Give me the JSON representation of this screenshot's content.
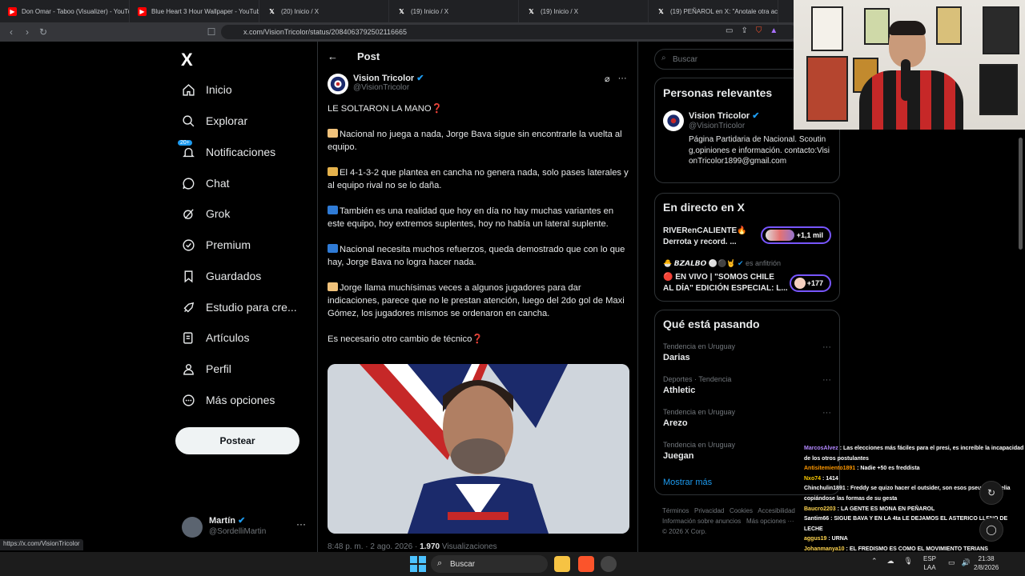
{
  "browser": {
    "tabs": [
      {
        "title": "Don Omar - Taboo (Visualizer) - YouTube",
        "icon": "youtube-icon"
      },
      {
        "title": "Blue Heart 3 Hour Wallpaper - YouTube",
        "icon": "youtube-icon"
      },
      {
        "title": "(20) Inicio / X",
        "icon": "x-icon"
      },
      {
        "title": "(19) Inicio / X",
        "icon": "x-icon"
      },
      {
        "title": "(19) Inicio / X",
        "icon": "x-icon"
      },
      {
        "title": "(19) PEÑAROL en X: \"Anotale otra ac",
        "icon": "x-icon"
      }
    ],
    "url": "x.com/VisionTricolor/status/2084063792502116665",
    "status_link": "https://x.com/VisionTricolor"
  },
  "sidebar": {
    "logo": "X",
    "items": [
      {
        "label": "Inicio",
        "icon": "home-icon"
      },
      {
        "label": "Explorar",
        "icon": "search-icon"
      },
      {
        "label": "Notificaciones",
        "icon": "bell-icon",
        "badge": "20+"
      },
      {
        "label": "Chat",
        "icon": "chat-icon"
      },
      {
        "label": "Grok",
        "icon": "grok-icon"
      },
      {
        "label": "Premium",
        "icon": "premium-icon"
      },
      {
        "label": "Guardados",
        "icon": "bookmark-icon"
      },
      {
        "label": "Estudio para cre...",
        "icon": "rocket-icon"
      },
      {
        "label": "Artículos",
        "icon": "article-icon"
      },
      {
        "label": "Perfil",
        "icon": "person-icon"
      },
      {
        "label": "Más opciones",
        "icon": "more-circle-icon"
      }
    ],
    "post_button": "Postear",
    "account": {
      "name": "Martín",
      "handle": "@SordelliMartin"
    }
  },
  "post": {
    "header": "Post",
    "author": {
      "name": "Vision Tricolor",
      "handle": "@VisionTricolor"
    },
    "paragraphs": [
      {
        "emoji": "",
        "text": "LE SOLTARON LA MANO❓"
      },
      {
        "emoji": "thumbs-down",
        "text": "Nacional no juega a nada, Jorge Bava sigue sin encontrarle la vuelta al equipo."
      },
      {
        "emoji": "person",
        "text": "El 4-1-3-2 que plantea en cancha no genera nada, solo pases laterales y al equipo rival no se lo daña."
      },
      {
        "emoji": "arrow",
        "text": "También es una realidad que hoy en día no hay muchas variantes en este equipo, hoy extremos suplentes, hoy no había un lateral suplente."
      },
      {
        "emoji": "arrow",
        "text": "Nacional necesita muchos refuerzos, queda demostrado que con lo que hay, Jorge Bava no logra hacer nada."
      },
      {
        "emoji": "pointing",
        "text": "Jorge llama muchísimas veces a algunos jugadores para dar indicaciones, parece que no le prestan atención, luego del 2do gol de Maxi Gómez, los jugadores mismos se ordenaron en cancha."
      },
      {
        "emoji": "",
        "text": "Es necesario otro cambio de técnico❓"
      }
    ],
    "meta": {
      "time": "8:48 p. m. · 2 ago. 2026 · ",
      "views": "1.970",
      "views_label": " Visualizaciones"
    }
  },
  "right": {
    "search_placeholder": "Buscar",
    "relevant": {
      "title": "Personas relevantes",
      "name": "Vision Tricolor",
      "handle": "@VisionTricolor",
      "bio": "Página Partidaria de Nacional. Scouting,opiniones e información. contacto:VisionTricolor1899@gmail.com"
    },
    "live": {
      "title": "En directo en X",
      "items": [
        {
          "title": "RIVERenCALIENTE🔥",
          "subtitle": "Derrota y record. ...",
          "count": "+1,1 mil"
        },
        {
          "host": "𝘽𝙕𝘼𝙇𝘽𝙊",
          "host_label": "es anfitrión",
          "title": "🔴 EN VIVO | \"SOMOS CHILE",
          "subtitle": "AL DÍA\" EDICIÓN ESPECIAL: L...",
          "count": "+177"
        }
      ]
    },
    "trending": {
      "title": "Qué está pasando",
      "items": [
        {
          "context": "Tendencia en Uruguay",
          "name": "Darias"
        },
        {
          "context": "Deportes · Tendencia",
          "name": "Athletic"
        },
        {
          "context": "Tendencia en Uruguay",
          "name": "Arezo"
        },
        {
          "context": "Tendencia en Uruguay",
          "name": "Juegan"
        }
      ],
      "show_more": "Mostrar más"
    },
    "footer": [
      "Términos",
      "Privacidad",
      "Cookies",
      "Accesibilidad",
      "Información sobre anuncios",
      "Más opciones ···",
      "© 2026 X Corp."
    ]
  },
  "chat_overlay": [
    {
      "user": "MarcosAlvez",
      "color": "#b388ff",
      "msg": "Las elecciones más fáciles para el presi, es increíble la incapacidad de los otros postulantes"
    },
    {
      "user": "Antisitemiento1891",
      "color": "#ff9800",
      "msg": "Nadie +50 es freddista"
    },
    {
      "user": "Nxo74",
      "color": "#ffcc00",
      "msg": "1414"
    },
    {
      "user": "Chinchulin1891",
      "color": "#ffffff",
      "msg": "Freddy se quizo hacer el outsider, son esos pseudos milelia copiándose las formas de su gesta"
    },
    {
      "user": "Baucro2203",
      "color": "#ffd54f",
      "msg": "LA GENTE ES MONA EN PEÑAROL"
    },
    {
      "user": "Santim66",
      "color": "#ffffff",
      "msg": "SIGUE BAVA Y EN LA 4ta LE DEJAMOS EL ASTERICO LLENO DE LECHE"
    },
    {
      "user": "aggus19",
      "color": "#ffd54f",
      "msg": "URNA"
    },
    {
      "user": "Johanmanya10",
      "color": "#ffd54f",
      "msg": "EL FREDISMO ES COMO EL MOVIMIENTO TERIANS"
    }
  ],
  "taskbar": {
    "search": "Buscar",
    "lang": [
      "ESP",
      "LAA"
    ],
    "time": "21:38",
    "date": "2/8/2026"
  },
  "colors": {
    "accent": "#1d9bf0",
    "background": "#000000",
    "border": "#2f3336"
  }
}
